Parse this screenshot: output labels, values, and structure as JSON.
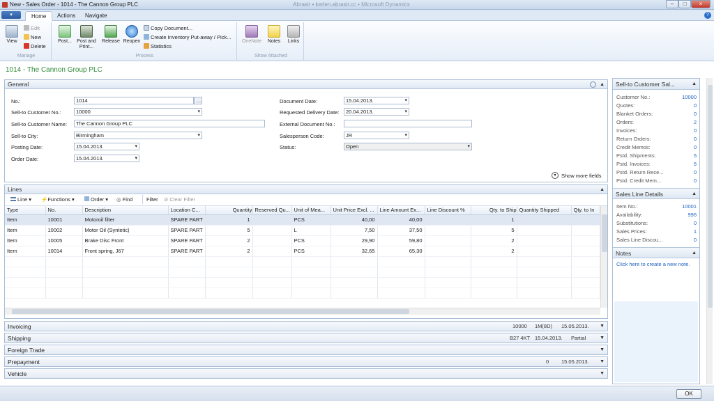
{
  "window": {
    "title": "New - Sales Order - 1014 - The Cannon Group PLC",
    "title_right": "Abrasir • kerlen.abrasir.cc • Microsoft Dynamics",
    "min": "–",
    "max": "□",
    "close": "×",
    "help": "?"
  },
  "ribbon": {
    "app_menu": "▾",
    "tabs": [
      "Home",
      "Actions",
      "Navigate"
    ],
    "groups": {
      "manage": {
        "label": "Manage",
        "view": "View",
        "edit": "Edit",
        "new": "New",
        "delete": "Delete"
      },
      "process": {
        "label": "Process",
        "post": "Post...",
        "post_print": "Post and Print...",
        "release": "Release",
        "reopen": "Reopen",
        "copy_document": "Copy Document...",
        "create_inventory": "Create Inventory Put-away / Pick...",
        "statistics": "Statistics"
      },
      "show_attached": {
        "label": "Show Attached",
        "onenote": "OneNote",
        "notes": "Notes",
        "links": "Links"
      }
    }
  },
  "page_title": "1014 - The Cannon Group PLC",
  "general": {
    "header": "General",
    "show_more": "Show more fields",
    "left": [
      {
        "label": "No.:",
        "value": "1014"
      },
      {
        "label": "Sell-to Customer No.:",
        "value": "10000"
      },
      {
        "label": "Sell-to Customer Name:",
        "value": "The Cannon Group PLC"
      },
      {
        "label": "Sell-to City:",
        "value": "Birmingham"
      },
      {
        "label": "Posting Date:",
        "value": "15.04.2013."
      },
      {
        "label": "Order Date:",
        "value": "15.04.2013."
      }
    ],
    "right": [
      {
        "label": "Document Date:",
        "value": "15.04.2013."
      },
      {
        "label": "Requested Delivery Date:",
        "value": "20.04.2013."
      },
      {
        "label": "External Document No.:",
        "value": ""
      },
      {
        "label": "Salesperson Code:",
        "value": "JR"
      },
      {
        "label": "Status:",
        "value": "Open"
      }
    ]
  },
  "lines": {
    "header": "Lines",
    "toolbar": {
      "line": "Line",
      "functions": "Functions",
      "order": "Order",
      "find": "Find",
      "filter": "Filter",
      "clear_filter": "Clear Filter"
    },
    "columns": [
      "Type",
      "No.",
      "Description",
      "Location C...",
      "Quantity",
      "Reserved Qu...",
      "Unit of Mea...",
      "Unit Price Excl. ...",
      "Line Amount Ex...",
      "Line Discount %",
      "Qty. to Ship",
      "Quantity Shipped",
      "Qty. to In"
    ],
    "rows": [
      [
        "Item",
        "10001",
        "Motoroil filter",
        "SPARE PART",
        "1",
        "",
        "PCS",
        "40,00",
        "40,00",
        "",
        "1",
        "",
        ""
      ],
      [
        "Item",
        "10002",
        "Motor Oil (Syntetic)",
        "SPARE PART",
        "5",
        "",
        "L",
        "7,50",
        "37,50",
        "",
        "5",
        "",
        ""
      ],
      [
        "Item",
        "10005",
        "Brake Disc Front",
        "SPARE PART",
        "2",
        "",
        "PCS",
        "29,90",
        "59,80",
        "",
        "2",
        "",
        ""
      ],
      [
        "Item",
        "10014",
        "Front spring, J67",
        "SPARE PART",
        "2",
        "",
        "PCS",
        "32,65",
        "65,30",
        "",
        "2",
        "",
        ""
      ]
    ]
  },
  "fasttabs": [
    {
      "label": "Invoicing",
      "values": [
        "10000",
        "1M(8D)",
        "15.05.2013."
      ]
    },
    {
      "label": "Shipping",
      "values": [
        "B27 4KT",
        "15.04.2013.",
        "Partial"
      ]
    },
    {
      "label": "Foreign Trade",
      "values": []
    },
    {
      "label": "Prepayment",
      "values": [
        "0",
        "15.05.2013."
      ]
    },
    {
      "label": "Vehicle",
      "values": []
    }
  ],
  "factbox": {
    "customer": {
      "header": "Sell-to Customer Sal...",
      "rows": [
        {
          "label": "Customer No.:",
          "value": "10000"
        },
        {
          "label": "Quotes:",
          "value": "0"
        },
        {
          "label": "Blanket Orders:",
          "value": "0"
        },
        {
          "label": "Orders:",
          "value": "2"
        },
        {
          "label": "Invoices:",
          "value": "0"
        },
        {
          "label": "Return Orders:",
          "value": "0"
        },
        {
          "label": "Credit Memos:",
          "value": "0"
        },
        {
          "label": "Pstd. Shipments:",
          "value": "5"
        },
        {
          "label": "Pstd. Invoices:",
          "value": "5"
        },
        {
          "label": "Pstd. Return Rece...",
          "value": "0"
        },
        {
          "label": "Pstd. Credit Mem...",
          "value": "0"
        }
      ]
    },
    "line_details": {
      "header": "Sales Line Details",
      "rows": [
        {
          "label": "Item No.:",
          "value": "10001"
        },
        {
          "label": "Availability:",
          "value": "996"
        },
        {
          "label": "Substitutions:",
          "value": "0"
        },
        {
          "label": "Sales Prices:",
          "value": "1"
        },
        {
          "label": "Sales Line Discou...",
          "value": "0"
        }
      ]
    },
    "notes": {
      "header": "Notes",
      "link": "Click here to create a new note."
    }
  },
  "ok_button": "OK",
  "colors": {
    "accent": "#2e8b3a",
    "link": "#1e63c0",
    "header": "#dde7f3"
  }
}
